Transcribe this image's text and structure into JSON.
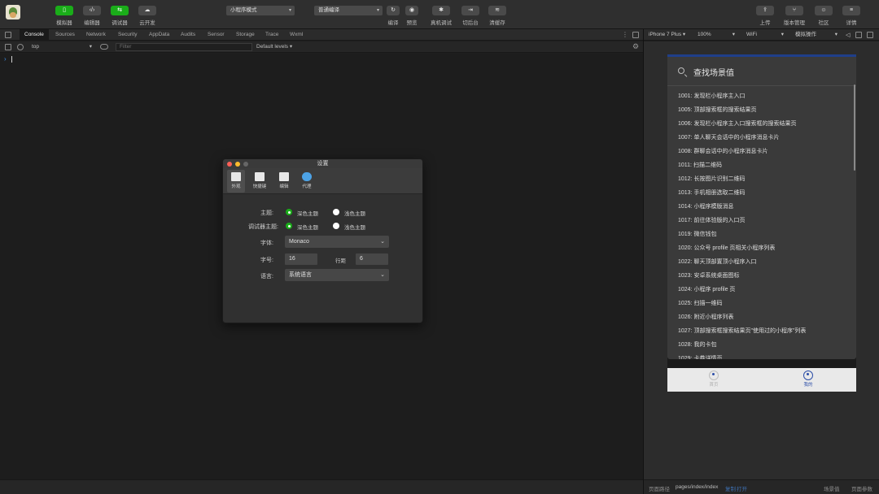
{
  "toolbar": {
    "left_buttons": [
      {
        "label": "模拟器",
        "icon": "phone-icon",
        "glyph": "▯"
      },
      {
        "label": "编辑器",
        "icon": "code-icon",
        "glyph": "‹/›"
      },
      {
        "label": "调试器",
        "icon": "debug-icon",
        "glyph": "⇆"
      },
      {
        "label": "云开发",
        "icon": "cloud-icon",
        "glyph": "☁"
      }
    ],
    "mode_select": "小程序模式",
    "compile_select": "普通编译",
    "mid_buttons": [
      {
        "label": "编译",
        "icon": "refresh-icon",
        "glyph": "↻"
      },
      {
        "label": "预览",
        "icon": "eye-icon",
        "glyph": "◉"
      },
      {
        "label": "真机调试",
        "icon": "bug-icon",
        "glyph": "✱"
      },
      {
        "label": "切后台",
        "icon": "switch-icon",
        "glyph": "⇥"
      },
      {
        "label": "清缓存",
        "icon": "layers-icon",
        "glyph": "≋"
      }
    ],
    "right_buttons": [
      {
        "label": "上传",
        "icon": "upload-icon",
        "glyph": "⇪"
      },
      {
        "label": "版本管理",
        "icon": "branch-icon",
        "glyph": "⑂"
      },
      {
        "label": "社区",
        "icon": "chat-icon",
        "glyph": "☺"
      },
      {
        "label": "详情",
        "icon": "menu-icon",
        "glyph": "≡"
      }
    ]
  },
  "devtools": {
    "tabs": [
      "Console",
      "Sources",
      "Network",
      "Security",
      "AppData",
      "Audits",
      "Sensor",
      "Storage",
      "Trace",
      "Wxml"
    ],
    "context": "top",
    "filter_placeholder": "Filter",
    "levels": "Default levels ▾",
    "prompt": "›"
  },
  "settings": {
    "title": "设置",
    "tabs": [
      {
        "label": "外观",
        "color": "#e8e8e8"
      },
      {
        "label": "快捷键",
        "color": "#e8e8e8"
      },
      {
        "label": "编辑",
        "color": "#e8e8e8"
      },
      {
        "label": "代理",
        "color": "#4da3e6"
      }
    ],
    "theme_label": "主题:",
    "debugger_theme_label": "调试器主题:",
    "dark_theme": "深色主题",
    "light_theme": "浅色主题",
    "font_label": "字体:",
    "font_value": "Monaco",
    "size_label": "字号:",
    "size_value": "16",
    "line_height_label": "行距",
    "line_height_value": "6",
    "language_label": "语言:",
    "language_value": "系统语言"
  },
  "simulator": {
    "device": "iPhone 7 Plus ▾",
    "zoom": "100%",
    "network": "WiFi",
    "operation": "模拟操作",
    "search_title": "查找场景值",
    "scenes": [
      "1001: 发现栏小程序主入口",
      "1005: 顶部搜索框的搜索结果页",
      "1006: 发现栏小程序主入口搜索框的搜索结果页",
      "1007: 单人聊天会话中的小程序消息卡片",
      "1008: 群聊会话中的小程序消息卡片",
      "1011: 扫描二维码",
      "1012: 长按图片识别二维码",
      "1013: 手机相册选取二维码",
      "1014: 小程序模版消息",
      "1017: 前往体验版的入口页",
      "1019: 微信钱包",
      "1020: 公众号 profile 页相关小程序列表",
      "1022: 聊天顶部置顶小程序入口",
      "1023: 安卓系统桌面图标",
      "1024: 小程序 profile 页",
      "1025: 扫描一维码",
      "1026: 附近小程序列表",
      "1027: 顶部搜索框搜索结果页\"使用过的小程序\"列表",
      "1028: 我的卡包",
      "1029: 卡券详情页"
    ],
    "tabbar": [
      {
        "label": "首页",
        "icon": "chat-bubble-icon"
      },
      {
        "label": "我的",
        "icon": "user-icon"
      }
    ]
  },
  "status": {
    "page_path_label": "页面路径",
    "page_path": "pages/index/index",
    "copy": "复制",
    "open": "打开",
    "scene_value": "场景值",
    "page_params": "页面参数"
  },
  "colors": {
    "accent_green": "#1aad19",
    "link_blue": "#3d8ee6",
    "active_tab_blue": "#2c4ea8"
  }
}
